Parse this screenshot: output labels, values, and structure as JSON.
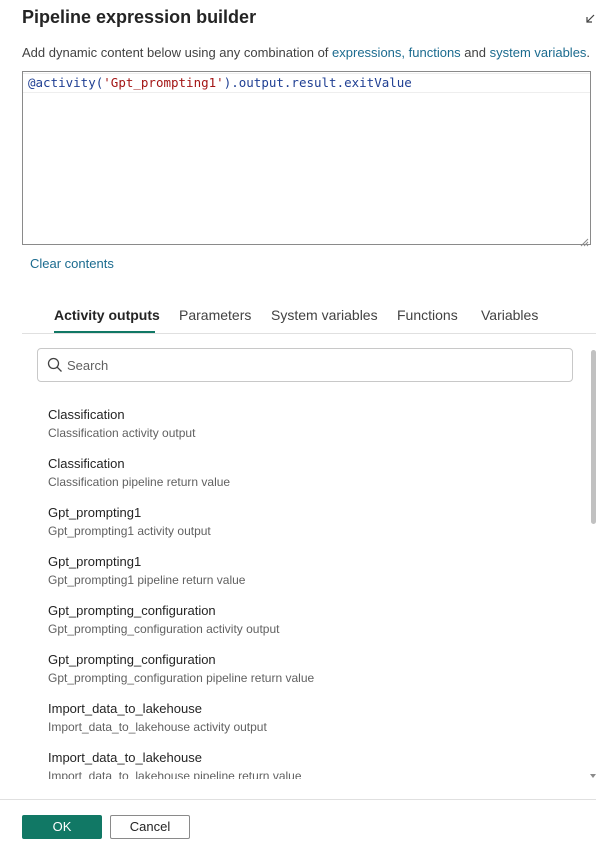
{
  "dialog": {
    "title": "Pipeline expression builder",
    "description_prefix": "Add dynamic content below using any combination of ",
    "link_expressions": "expressions,",
    "link_functions": "functions",
    "description_and": " and ",
    "link_system_variables": "system variables",
    "description_suffix": "."
  },
  "editor": {
    "token_fn": "@activity(",
    "token_str": "'Gpt_prompting1'",
    "token_rest": ").output.result.exitValue"
  },
  "clear_contents": "Clear contents",
  "tabs": [
    {
      "label": "Activity outputs",
      "active": true
    },
    {
      "label": "Parameters",
      "active": false
    },
    {
      "label": "System variables",
      "active": false
    },
    {
      "label": "Functions",
      "active": false
    },
    {
      "label": "Variables",
      "active": false
    }
  ],
  "search": {
    "placeholder": "Search",
    "value": ""
  },
  "items": [
    {
      "title": "Classification",
      "subtitle": "Classification activity output"
    },
    {
      "title": "Classification",
      "subtitle": "Classification pipeline return value"
    },
    {
      "title": "Gpt_prompting1",
      "subtitle": "Gpt_prompting1 activity output"
    },
    {
      "title": "Gpt_prompting1",
      "subtitle": "Gpt_prompting1 pipeline return value"
    },
    {
      "title": "Gpt_prompting_configuration",
      "subtitle": "Gpt_prompting_configuration activity output"
    },
    {
      "title": "Gpt_prompting_configuration",
      "subtitle": "Gpt_prompting_configuration pipeline return value"
    },
    {
      "title": "Import_data_to_lakehouse",
      "subtitle": "Import_data_to_lakehouse activity output"
    },
    {
      "title": "Import_data_to_lakehouse",
      "subtitle": "Import_data_to_lakehouse pipeline return value"
    }
  ],
  "buttons": {
    "ok": "OK",
    "cancel": "Cancel"
  },
  "colors": {
    "accent": "#117865",
    "link": "#1b6b8f",
    "code_function": "#1f3f93",
    "code_string": "#a31515"
  },
  "icons": {
    "collapse": "collapse-arrow-icon",
    "search": "search-icon",
    "resize": "resize-grip-icon",
    "scroll_down": "chevron-down-icon"
  }
}
